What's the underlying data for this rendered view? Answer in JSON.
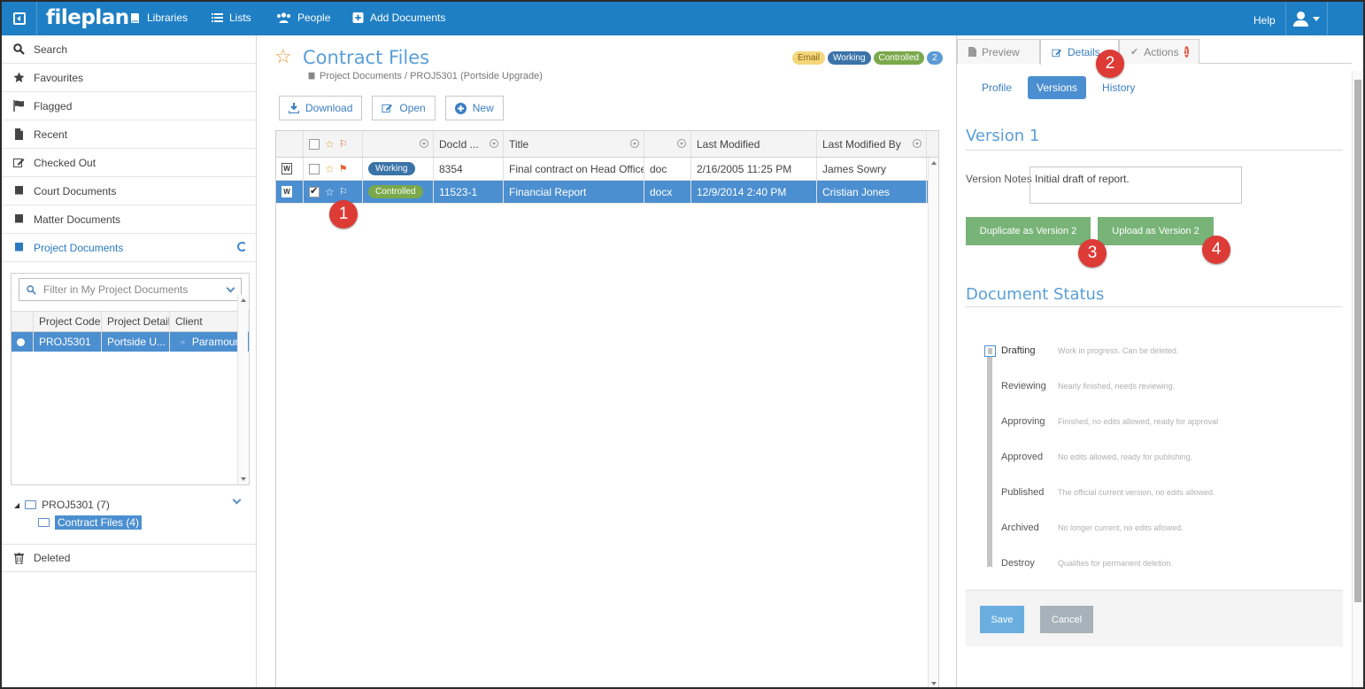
{
  "topbar": {
    "logo": "fileplan",
    "nav": [
      {
        "label": "Libraries",
        "icon": "book-icon"
      },
      {
        "label": "Lists",
        "icon": "list-icon"
      },
      {
        "label": "People",
        "icon": "people-icon"
      },
      {
        "label": "Add Documents",
        "icon": "plus-square-icon"
      }
    ],
    "help": "Help"
  },
  "sidebar": {
    "items": [
      {
        "label": "Search",
        "icon": "search-icon"
      },
      {
        "label": "Favourites",
        "icon": "star-icon"
      },
      {
        "label": "Flagged",
        "icon": "flag-icon"
      },
      {
        "label": "Recent",
        "icon": "document-icon"
      },
      {
        "label": "Checked Out",
        "icon": "edit-icon"
      },
      {
        "label": "Court Documents",
        "icon": "book-icon"
      },
      {
        "label": "Matter Documents",
        "icon": "book-icon"
      },
      {
        "label": "Project Documents",
        "icon": "book-icon"
      }
    ],
    "filter_placeholder": "Filter in My Project Documents",
    "project_table": {
      "headers": [
        "Project Code",
        "Project Detail",
        "Client"
      ],
      "rows": [
        [
          "PROJ5301",
          "Portside U...",
          "Paramoun"
        ]
      ]
    },
    "tree": {
      "root": "PROJ5301 (7)",
      "child": "Contract Files (4)"
    },
    "deleted": "Deleted"
  },
  "center": {
    "title": "Contract Files",
    "breadcrumb": "Project Documents / PROJ5301 (Portside Upgrade)",
    "badges": [
      "Email",
      "Working",
      "Controlled",
      "2"
    ],
    "toolbar": {
      "download": "Download",
      "open": "Open",
      "new": "New"
    },
    "grid": {
      "headers": [
        "",
        "",
        "",
        "DocId ...",
        "Title",
        "",
        "Last Modified",
        "Last Modified By"
      ],
      "rows": [
        {
          "status": "Working",
          "docid": "8354",
          "title": "Final contract on Head Office",
          "ext": "doc",
          "modified": "2/16/2005 11:25 PM",
          "by": "James Sowry"
        },
        {
          "status": "Controlled",
          "docid": "11523-1",
          "title": "Financial Report",
          "ext": "docx",
          "modified": "12/9/2014 2:40 PM",
          "by": "Cristian Jones"
        }
      ]
    }
  },
  "right": {
    "tabs": {
      "preview": "Preview",
      "details": "Details",
      "actions": "Actions",
      "actions_count": "1"
    },
    "subtabs": {
      "profile": "Profile",
      "versions": "Versions",
      "history": "History"
    },
    "version_title": "Version 1",
    "version_notes_label": "Version Notes",
    "version_notes_value": "Initial draft of report.",
    "duplicate_btn": "Duplicate as Version 2",
    "upload_btn": "Upload as Version 2",
    "status_title": "Document Status",
    "statuses": [
      {
        "name": "Drafting",
        "desc": "Work in progress. Can be deleted."
      },
      {
        "name": "Reviewing",
        "desc": "Nearly finished, needs reviewing."
      },
      {
        "name": "Approving",
        "desc": "Finished, no edits allowed, ready for approval"
      },
      {
        "name": "Approved",
        "desc": "No edits allowed, ready for publishing."
      },
      {
        "name": "Published",
        "desc": "The official current version, no edits allowed."
      },
      {
        "name": "Archived",
        "desc": "No longer current, no edits allowed."
      },
      {
        "name": "Destroy",
        "desc": "Qualifies for permanent deletion."
      }
    ],
    "save": "Save",
    "cancel": "Cancel"
  },
  "callouts": [
    "1",
    "2",
    "3",
    "4"
  ],
  "colors": {
    "brand": "#1f7fc4",
    "selection": "#4c8fd0",
    "green_button": "#78b378",
    "callout": "#dd3b36"
  }
}
